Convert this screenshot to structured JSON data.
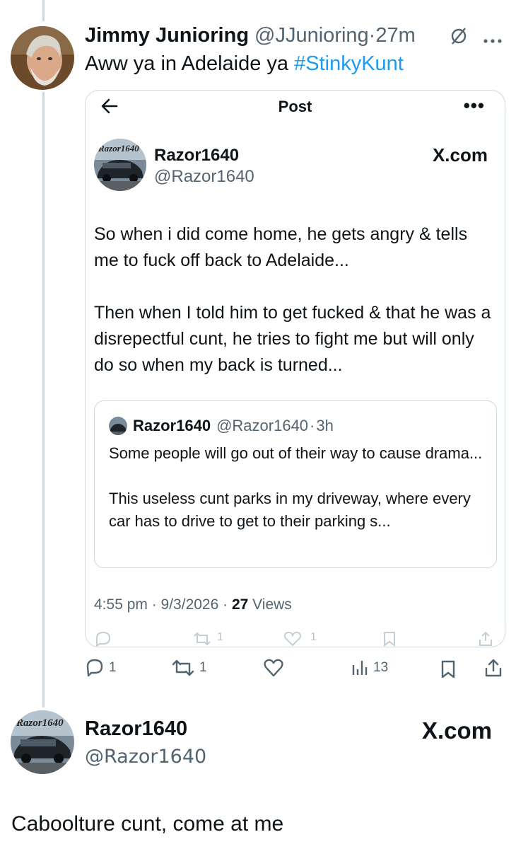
{
  "reply": {
    "author_name": "Jimmy Junioring",
    "handle": "@JJunioring",
    "separator": "·",
    "time": "27m",
    "text_prefix": "Aww ya in Adelaide ya ",
    "hashtag": "#StinkyKunt",
    "icons": [
      "grok-slash-icon",
      "more-icon"
    ]
  },
  "embed": {
    "header_title": "Post",
    "back_icon": "back-arrow-icon",
    "more_label": "•••",
    "author_name": "Razor1640",
    "handle": "@Razor1640",
    "site_label": "X.com",
    "paragraphs": [
      "So when i did come home, he gets angry & tells me to fuck off back to Adelaide...",
      "Then when I told him to get fucked & that he was a disrepectful cunt, he tries to fight me but will only do so when my back is turned..."
    ],
    "quote": {
      "author_name": "Razor1640",
      "handle": "@Razor1640",
      "separator": "·",
      "time": "3h",
      "paragraphs": [
        "Some people will go out of their way to cause drama...",
        "This useless cunt parks in my driveway, where every car has to drive to get to their parking s..."
      ]
    },
    "meta_time": "4:55 pm · 9/3/2026 · ",
    "views_count": "27",
    "views_label": " Views",
    "action_counts": {
      "retweets": "1",
      "likes": "1"
    }
  },
  "actions": {
    "replies": "1",
    "retweets": "1",
    "views": "13"
  },
  "second_post": {
    "author_name": "Razor1640",
    "handle": "@Razor1640",
    "site_label": "X.com",
    "text": "Caboolture cunt, come at me"
  },
  "colors": {
    "link": "#1d9bf0",
    "secondary_text": "#536471",
    "border": "#cfd9de"
  }
}
